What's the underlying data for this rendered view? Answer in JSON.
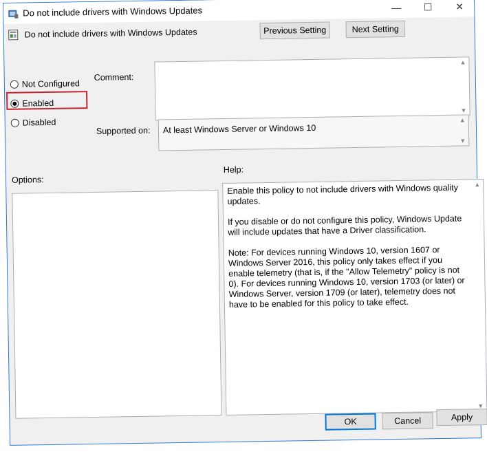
{
  "window": {
    "title": "Do not include drivers with Windows Updates",
    "min_icon": "—",
    "max_icon": "☐",
    "close_icon": "✕"
  },
  "header": {
    "policy_name": "Do not include drivers with Windows Updates",
    "prev_label": "Previous Setting",
    "next_label": "Next Setting"
  },
  "state": {
    "options": [
      {
        "label": "Not Configured",
        "selected": false
      },
      {
        "label": "Enabled",
        "selected": true
      },
      {
        "label": "Disabled",
        "selected": false
      }
    ],
    "highlight_color": "#c4262e"
  },
  "fields": {
    "comment_label": "Comment:",
    "comment_value": "",
    "supported_label": "Supported on:",
    "supported_value": "At least Windows Server or Windows 10"
  },
  "sections": {
    "options_label": "Options:",
    "help_label": "Help:",
    "help_paragraphs": [
      "Enable this policy to not include drivers with Windows quality updates.",
      "If you disable or do not configure this policy, Windows Update will include updates that have a Driver classification.",
      "Note: For devices running Windows 10, version 1607 or Windows Server 2016, this policy only takes effect if you enable telemetry (that is, if the \"Allow Telemetry\" policy is not 0). For devices running Windows 10, version 1703 (or later) or Windows Server, version 1709 (or later), telemetry does not have to be enabled for this policy to take effect."
    ]
  },
  "footer": {
    "ok_label": "OK",
    "cancel_label": "Cancel",
    "apply_label": "Apply"
  },
  "colors": {
    "accent": "#0078d7",
    "window_bg": "#f0f0f0"
  }
}
